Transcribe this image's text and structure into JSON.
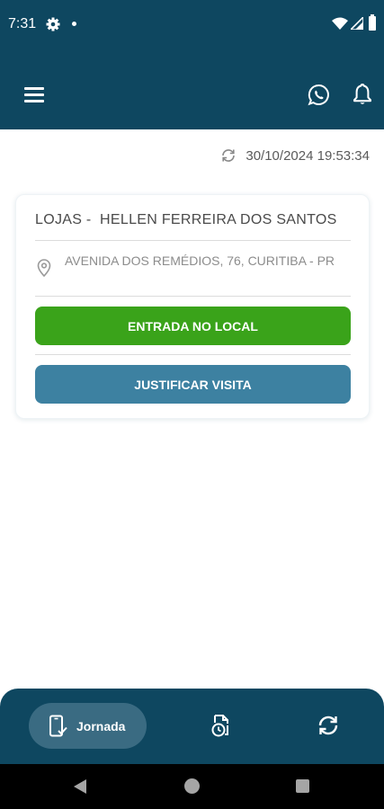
{
  "status_bar": {
    "time": "7:31",
    "icons": [
      "gear-icon",
      "dot-icon",
      "wifi-icon",
      "signal-icon",
      "battery-icon"
    ]
  },
  "app_bar": {
    "icons": [
      "menu-icon",
      "whatsapp-icon",
      "bell-icon"
    ]
  },
  "sync": {
    "timestamp": "30/10/2024 19:53:34",
    "icon": "refresh-icon"
  },
  "card": {
    "title": "LOJAS -  HELLEN FERREIRA DOS SANTOS",
    "address": "AVENIDA DOS REMÉDIOS, 76, CURITIBA - PR",
    "buttons": {
      "check_in": "ENTRADA NO LOCAL",
      "justify": "JUSTIFICAR VISITA"
    }
  },
  "bottom_nav": {
    "tabs": [
      {
        "label": "Jornada",
        "icon": "phone-check-icon",
        "active": true
      },
      {
        "label": "",
        "icon": "document-clock-icon",
        "active": false
      },
      {
        "label": "",
        "icon": "sync-icon",
        "active": false
      }
    ]
  },
  "colors": {
    "header": "#0e4760",
    "green_button": "#3aa31a",
    "blue_button": "#3d81a1",
    "active_tab": "#3a6b82"
  }
}
